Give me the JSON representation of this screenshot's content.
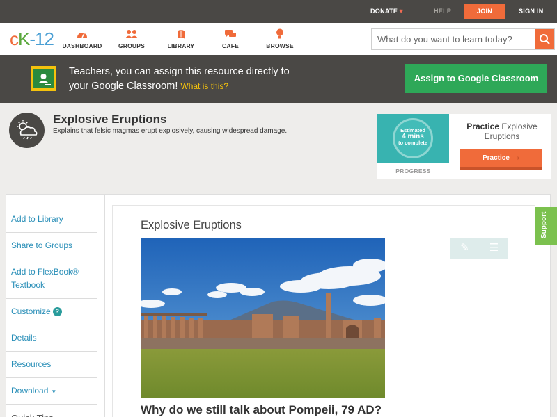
{
  "topbar": {
    "donate": "DONATE",
    "help": "HELP",
    "join": "JOIN",
    "signin": "SIGN IN"
  },
  "brand": {
    "logo_c": "c",
    "logo_k": "K",
    "logo_n": "-12"
  },
  "nav": {
    "items": [
      {
        "label": "DASHBOARD",
        "icon": "dashboard-icon"
      },
      {
        "label": "GROUPS",
        "icon": "groups-icon"
      },
      {
        "label": "LIBRARY",
        "icon": "library-icon"
      },
      {
        "label": "CAFE",
        "icon": "cafe-icon"
      },
      {
        "label": "BROWSE",
        "icon": "browse-icon"
      }
    ]
  },
  "search": {
    "placeholder": "What do you want to learn today?"
  },
  "google_banner": {
    "line1": "Teachers, you can assign this resource directly to",
    "line2": "your Google Classroom!",
    "what_link": "What is this?",
    "button": "Assign to Google Classroom"
  },
  "header": {
    "title": "Explosive Eruptions",
    "description": "Explains that felsic magmas erupt explosively, causing widespread damage."
  },
  "practice": {
    "ring_line1": "Estimated",
    "ring_line2": "4 mins",
    "ring_line3": "to complete",
    "progress_label": "PROGRESS",
    "title_bold": "Practice",
    "title_rest": "Explosive Eruptions",
    "button": "Practice"
  },
  "sidebar": {
    "items": [
      "Add to Library",
      "Share to Groups",
      "Add to FlexBook® Textbook",
      "Customize",
      "Details",
      "Resources",
      "Download",
      "Quick Tips"
    ]
  },
  "article": {
    "title": "Explosive Eruptions",
    "heading": "Why do we still talk about Pompeii, 79 AD?"
  },
  "support": {
    "label": "Support"
  },
  "colors": {
    "accent": "#f06b3a",
    "green": "#2ea858",
    "link": "#2a8fb8",
    "dark_bar": "#4a4845"
  }
}
